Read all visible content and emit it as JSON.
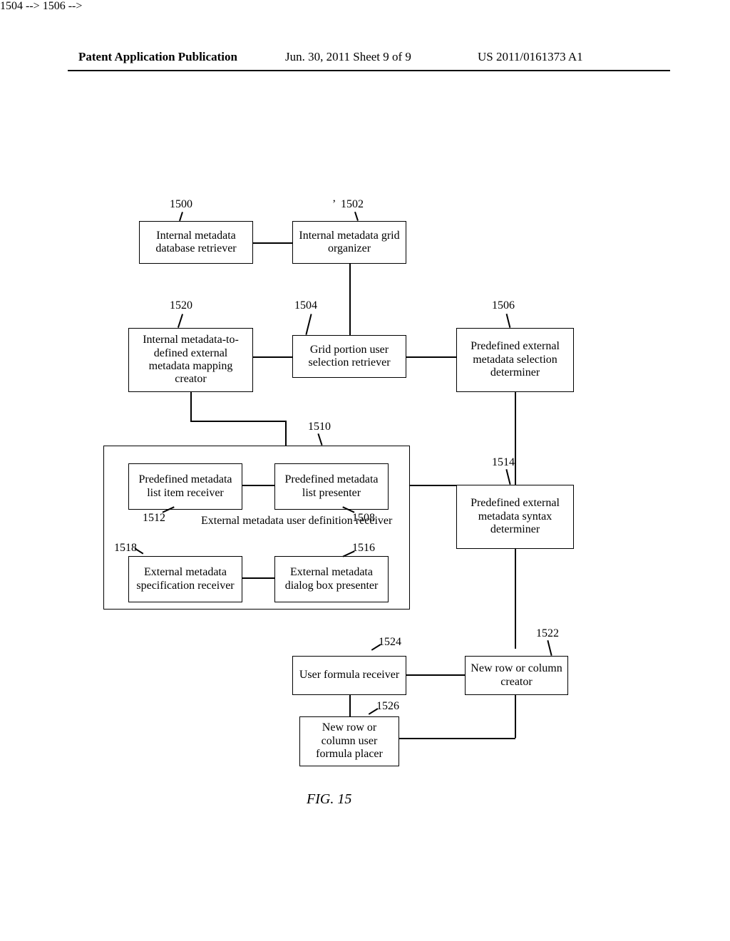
{
  "header": {
    "left": "Patent Application Publication",
    "mid": "Jun. 30, 2011   Sheet 9 of 9",
    "right": "US 2011/0161373 A1"
  },
  "nodes": {
    "n1500": "Internal metadata database retriever",
    "n1502": "Internal metadata grid organizer",
    "n1520": "Internal metadata-to-defined external metadata mapping creator",
    "n1504": "Grid portion user selection retriever",
    "n1506": "Predefined external metadata selection determiner",
    "n1512": "Predefined metadata list item receiver",
    "n1508": "Predefined metadata list presenter",
    "n1510label": "External metadata user definition receiver",
    "n1518": "External metadata specification receiver",
    "n1516": "External metadata dialog box presenter",
    "n1514": "Predefined external metadata syntax determiner",
    "n1524": "User formula receiver",
    "n1522": "New row or column creator",
    "n1526": "New row or column user formula placer"
  },
  "refs": {
    "r1500": "1500",
    "r1502": "1502",
    "r1520": "1520",
    "r1504": "1504",
    "r1506": "1506",
    "r1512": "1512",
    "r1508": "1508",
    "r1510": "1510",
    "r1518": "1518",
    "r1516": "1516",
    "r1514": "1514",
    "r1524": "1524",
    "r1522": "1522",
    "r1526": "1526"
  },
  "figure": "FIG. 15"
}
